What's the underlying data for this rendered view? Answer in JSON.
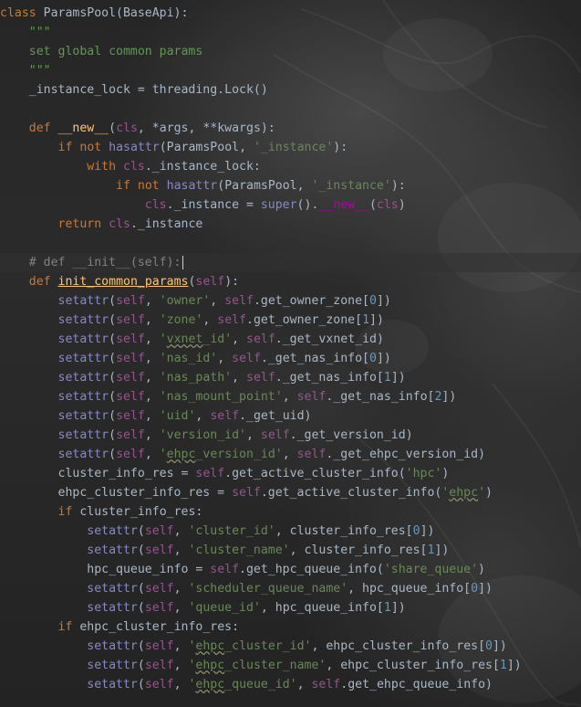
{
  "editor": {
    "language": "python",
    "theme": "darcula",
    "caret_line": 13
  },
  "code_lines": [
    "class ParamsPool(BaseApi):",
    "    \"\"\"",
    "    set global common params",
    "    \"\"\"",
    "    _instance_lock = threading.Lock()",
    "",
    "    def __new__(cls, *args, **kwargs):",
    "        if not hasattr(ParamsPool, '_instance'):",
    "            with cls._instance_lock:",
    "                if not hasattr(ParamsPool, '_instance'):",
    "                    cls._instance = super().__new__(cls)",
    "        return cls._instance",
    "",
    "    # def __init__(self):",
    "    def init_common_params(self):",
    "        setattr(self, 'owner', self.get_owner_zone[0])",
    "        setattr(self, 'zone', self.get_owner_zone[1])",
    "        setattr(self, 'vxnet_id', self._get_vxnet_id)",
    "        setattr(self, 'nas_id', self._get_nas_info[0])",
    "        setattr(self, 'nas_path', self._get_nas_info[1])",
    "        setattr(self, 'nas_mount_point', self._get_nas_info[2])",
    "        setattr(self, 'uid', self._get_uid)",
    "        setattr(self, 'version_id', self._get_version_id)",
    "        setattr(self, 'ehpc_version_id', self._get_ehpc_version_id)",
    "        cluster_info_res = self.get_active_cluster_info('hpc')",
    "        ehpc_cluster_info_res = self.get_active_cluster_info('ehpc')",
    "        if cluster_info_res:",
    "            setattr(self, 'cluster_id', cluster_info_res[0])",
    "            setattr(self, 'cluster_name', cluster_info_res[1])",
    "            hpc_queue_info = self.get_hpc_queue_info('share_queue')",
    "            setattr(self, 'scheduler_queue_name', hpc_queue_info[0])",
    "            setattr(self, 'queue_id', hpc_queue_info[1])",
    "        if ehpc_cluster_info_res:",
    "            setattr(self, 'ehpc_cluster_id', ehpc_cluster_info_res[0])",
    "            setattr(self, 'ehpc_cluster_name', ehpc_cluster_info_res[1])",
    "            setattr(self, 'ehpc_queue_id', self.get_ehpc_queue_info)"
  ],
  "colors": {
    "background": "#2b2b2b",
    "default_text": "#a9b7c6",
    "keyword": "#cc7832",
    "string": "#6a8759",
    "docstring": "#629755",
    "function": "#ffc66d",
    "self": "#94558d",
    "builtin": "#8888c6",
    "number": "#6897bb",
    "magic_method": "#b200b2",
    "comment": "#808080"
  }
}
